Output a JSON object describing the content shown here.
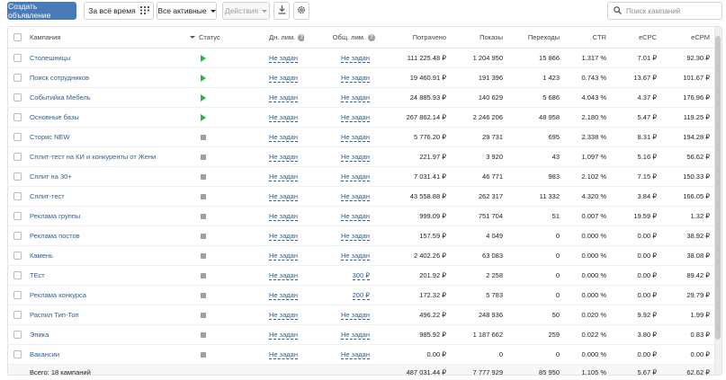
{
  "toolbar": {
    "create_label": "Создать объявление",
    "period_label": "За всё время",
    "filter_label": "Все активные",
    "actions_label": "Действия",
    "search_placeholder": "Поиск кампаний"
  },
  "table": {
    "headers": {
      "campaign": "Кампания",
      "status": "Статус",
      "daily": "Дн. лим.",
      "total": "Общ. лим.",
      "spent": "Потрачено",
      "impressions": "Показы",
      "clicks": "Переходы",
      "ctr": "CTR",
      "ecpc": "eCPC",
      "ecpm": "eCPM"
    },
    "rows": [
      {
        "name": "Столешницы",
        "status": "active",
        "daily": "Не задан",
        "total": "Не задан",
        "spent": "111 225.48 ₽",
        "impressions": "1 204 950",
        "clicks": "15 866",
        "ctr": "1.317 %",
        "ecpc": "7.01 ₽",
        "ecpm": "92.30 ₽"
      },
      {
        "name": "Поиск сотрудников",
        "status": "active",
        "daily": "Не задан",
        "total": "Не задан",
        "spent": "19 460.91 ₽",
        "impressions": "191 396",
        "clicks": "1 423",
        "ctr": "0.743 %",
        "ecpc": "13.67 ₽",
        "ecpm": "101.67 ₽"
      },
      {
        "name": "Событийка Мебель",
        "status": "active",
        "daily": "Не задан",
        "total": "Не задан",
        "spent": "24 885.93 ₽",
        "impressions": "140 629",
        "clicks": "5 686",
        "ctr": "4.043 %",
        "ecpc": "4.37 ₽",
        "ecpm": "176.96 ₽"
      },
      {
        "name": "Основные базы",
        "status": "active",
        "daily": "Не задан",
        "total": "Не задан",
        "spent": "267 862.14 ₽",
        "impressions": "2 246 206",
        "clicks": "48 958",
        "ctr": "2.180 %",
        "ecpc": "5.47 ₽",
        "ecpm": "119.25 ₽"
      },
      {
        "name": "Сторис NEW",
        "status": "stopped",
        "daily": "Не задан",
        "total": "Не задан",
        "spent": "5 776.20 ₽",
        "impressions": "29 731",
        "clicks": "695",
        "ctr": "2.338 %",
        "ecpc": "8.31 ₽",
        "ecpm": "194.28 ₽"
      },
      {
        "name": "Сплит-тест на КИ и конкуренты от Жени",
        "status": "stopped",
        "daily": "Не задан",
        "total": "Не задан",
        "spent": "221.97 ₽",
        "impressions": "3 920",
        "clicks": "43",
        "ctr": "1.097 %",
        "ecpc": "5.16 ₽",
        "ecpm": "56.62 ₽"
      },
      {
        "name": "Сплит на 30+",
        "status": "stopped",
        "daily": "Не задан",
        "total": "Не задан",
        "spent": "7 031.41 ₽",
        "impressions": "46 771",
        "clicks": "983",
        "ctr": "2.102 %",
        "ecpc": "7.15 ₽",
        "ecpm": "150.33 ₽"
      },
      {
        "name": "Сплит-тест",
        "status": "stopped",
        "daily": "Не задан",
        "total": "Не задан",
        "spent": "43 558.88 ₽",
        "impressions": "262 317",
        "clicks": "11 332",
        "ctr": "4.320 %",
        "ecpc": "3.84 ₽",
        "ecpm": "166.05 ₽"
      },
      {
        "name": "Реклама группы",
        "status": "stopped",
        "daily": "Не задан",
        "total": "Не задан",
        "spent": "999.09 ₽",
        "impressions": "751 704",
        "clicks": "51",
        "ctr": "0.007 %",
        "ecpc": "19.59 ₽",
        "ecpm": "1.32 ₽"
      },
      {
        "name": "Реклама постов",
        "status": "stopped",
        "daily": "Не задан",
        "total": "Не задан",
        "spent": "157.59 ₽",
        "impressions": "4 049",
        "clicks": "0",
        "ctr": "0.000 %",
        "ecpc": "0.00 ₽",
        "ecpm": "38.92 ₽"
      },
      {
        "name": "Камень",
        "status": "stopped",
        "daily": "Не задан",
        "total": "Не задан",
        "spent": "2 402.26 ₽",
        "impressions": "63 083",
        "clicks": "0",
        "ctr": "0.000 %",
        "ecpc": "0.00 ₽",
        "ecpm": "38.08 ₽"
      },
      {
        "name": "ТЕст",
        "status": "stopped",
        "daily": "Не задан",
        "total": "300 ₽",
        "spent": "201.92 ₽",
        "impressions": "2 258",
        "clicks": "0",
        "ctr": "0.000 %",
        "ecpc": "0.00 ₽",
        "ecpm": "89.42 ₽"
      },
      {
        "name": "Реклама конкурса",
        "status": "stopped",
        "daily": "Не задан",
        "total": "200 ₽",
        "spent": "172.32 ₽",
        "impressions": "5 783",
        "clicks": "0",
        "ctr": "0.000 %",
        "ecpc": "0.00 ₽",
        "ecpm": "29.79 ₽"
      },
      {
        "name": "Распил Тип-Топ",
        "status": "stopped",
        "daily": "Не задан",
        "total": "Не задан",
        "spent": "496.22 ₽",
        "impressions": "248 936",
        "clicks": "50",
        "ctr": "0.020 %",
        "ecpc": "9.92 ₽",
        "ecpm": "1.99 ₽"
      },
      {
        "name": "Эпика",
        "status": "stopped",
        "daily": "Не задан",
        "total": "Не задан",
        "spent": "985.92 ₽",
        "impressions": "1 187 662",
        "clicks": "259",
        "ctr": "0.022 %",
        "ecpc": "3.80 ₽",
        "ecpm": "0.83 ₽"
      },
      {
        "name": "Вакансии",
        "status": "stopped",
        "daily": "Не задан",
        "total": "Не задан",
        "spent": "0.00 ₽",
        "impressions": "0",
        "clicks": "0",
        "ctr": "0.000 %",
        "ecpc": "0.00 ₽",
        "ecpm": "0.00 ₽"
      }
    ],
    "footer": {
      "label": "Всего: 18 кампаний",
      "spent": "487 031.44 ₽",
      "impressions": "7 777 929",
      "clicks": "85 950",
      "ctr": "1.105 %",
      "ecpc": "5.67 ₽",
      "ecpm": "62.62 ₽"
    }
  },
  "colors": {
    "primary": "#4a7bb7",
    "link": "#2d5f93",
    "active_status": "#2db34a",
    "stopped_status": "#9aa0a6"
  },
  "icons": {
    "period": "calendar-grid-icon",
    "export": "download-icon",
    "settings": "gear-icon",
    "search": "search-icon",
    "status_active": "play-icon",
    "status_stopped": "stop-icon"
  }
}
